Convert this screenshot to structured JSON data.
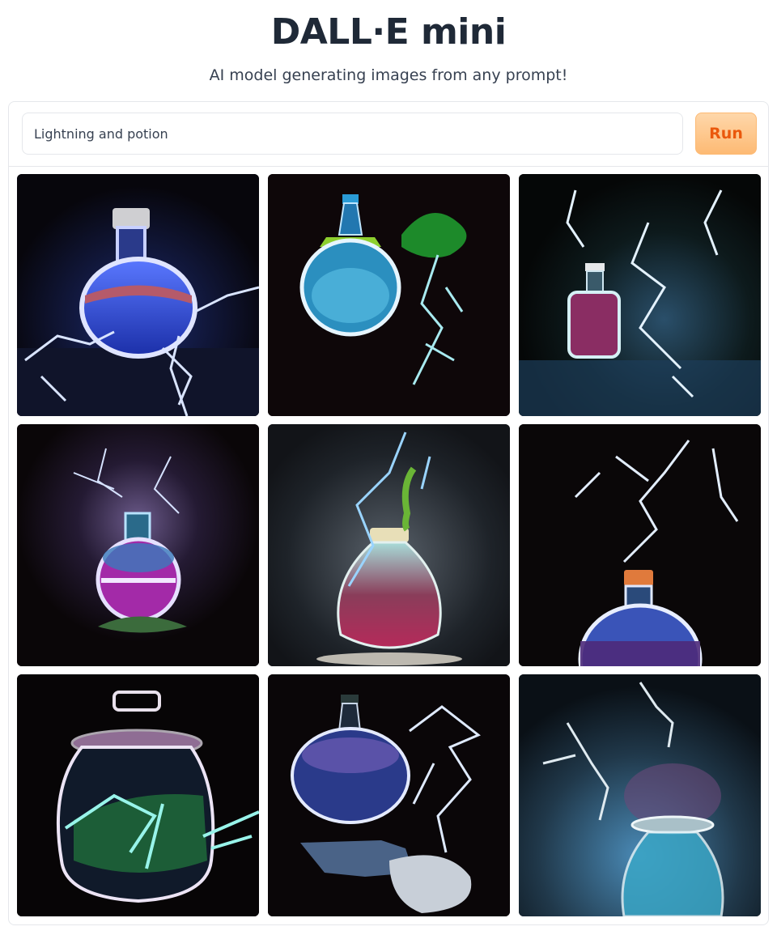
{
  "header": {
    "title": "DALL·E mini",
    "subtitle": "AI model generating images from any prompt!"
  },
  "prompt": {
    "value": "Lightning and potion"
  },
  "run_button": {
    "label": "Run"
  },
  "colors": {
    "accent_bg": "#fdba74",
    "accent_text": "#ea580c",
    "border": "#e5e7eb"
  },
  "gallery": {
    "images": [
      {
        "name": "generated-image-1"
      },
      {
        "name": "generated-image-2"
      },
      {
        "name": "generated-image-3"
      },
      {
        "name": "generated-image-4"
      },
      {
        "name": "generated-image-5"
      },
      {
        "name": "generated-image-6"
      },
      {
        "name": "generated-image-7"
      },
      {
        "name": "generated-image-8"
      },
      {
        "name": "generated-image-9"
      }
    ]
  }
}
